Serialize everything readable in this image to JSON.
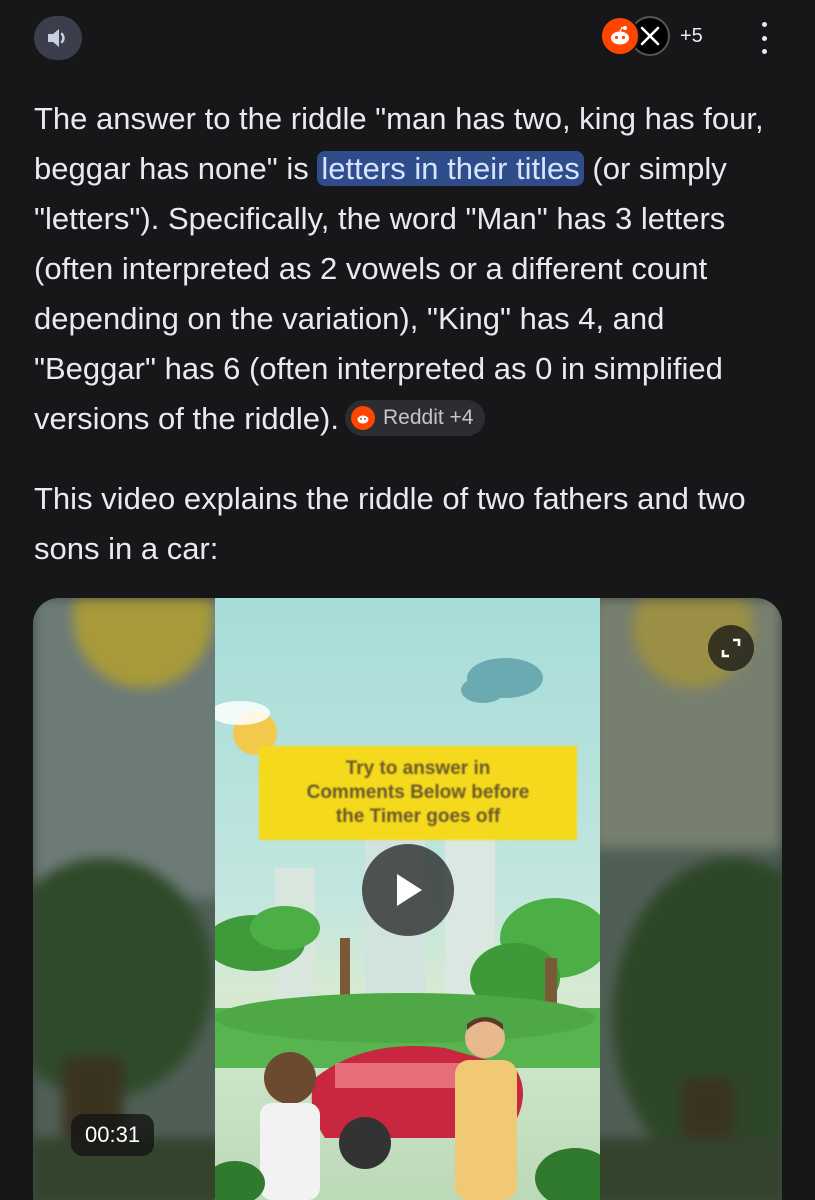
{
  "header": {
    "speaker_icon": "speaker-icon",
    "sources": [
      {
        "name": "Reddit",
        "icon": "reddit-icon"
      },
      {
        "name": "X",
        "icon": "x-icon"
      }
    ],
    "more_sources_label": "+5",
    "menu_icon": "more-vert-icon"
  },
  "answer": {
    "text_before": "The answer to the riddle \"man has two, king has four, beggar has none\" is ",
    "highlight": "letters in their titles",
    "text_after": " (or simply \"letters\"). Specifically, the word \"Man\" has 3 letters (often interpreted as 2 vowels or a different count depending on the variation), \"King\" has 4, and \"Beggar\" has 6 (often interpreted as 0 in simplified versions of the riddle).",
    "citation_chip": "Reddit +4"
  },
  "intro_text": "This video explains the riddle of two fathers and two sons in a car:",
  "video": {
    "caption_lines": [
      "Try to answer in",
      "Comments Below before",
      "the Timer goes off"
    ],
    "duration": "00:31",
    "colors": {
      "caption_bg": "#f5d91c",
      "overlay": "#282828"
    }
  }
}
